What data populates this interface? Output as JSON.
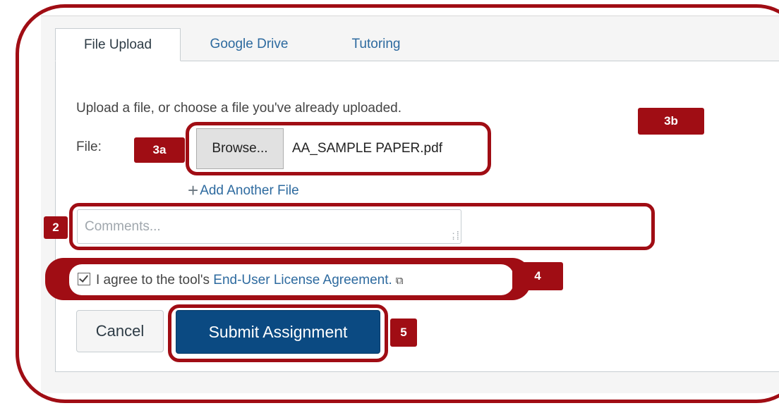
{
  "tabs": [
    {
      "label": "File Upload",
      "active": true
    },
    {
      "label": "Google Drive",
      "active": false
    },
    {
      "label": "Tutoring",
      "active": false
    }
  ],
  "upload": {
    "instructions": "Upload a file, or choose a file you've already uploaded.",
    "file_label": "File:",
    "browse_label": "Browse...",
    "file_name": "AA_SAMPLE PAPER.pdf",
    "add_another_label": "Add Another File"
  },
  "comments": {
    "placeholder": "Comments..."
  },
  "agreement": {
    "checked": true,
    "text_prefix": "I agree to the tool's ",
    "link_text": "End-User License Agreement."
  },
  "actions": {
    "cancel_label": "Cancel",
    "submit_label": "Submit Assignment"
  },
  "callouts": {
    "c2": "2",
    "c3a": "3a",
    "c3b": "3b",
    "c4": "4",
    "c5": "5"
  },
  "colors": {
    "annotation_red": "#a00d14",
    "link_blue": "#2d6a9f",
    "primary_button": "#0b4a82"
  }
}
